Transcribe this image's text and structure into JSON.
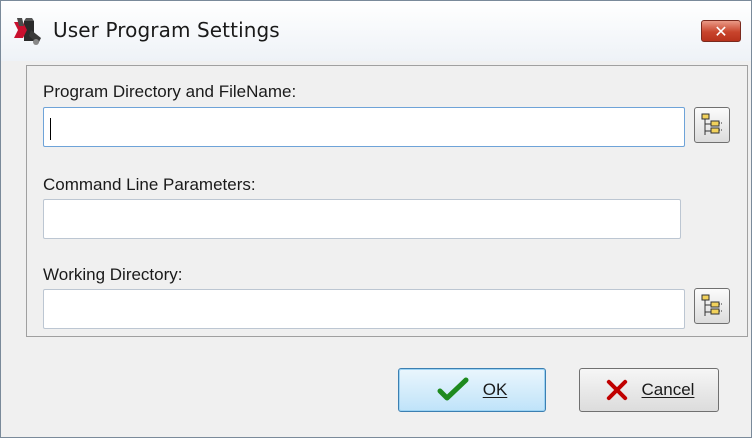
{
  "window": {
    "title": "User Program Settings",
    "close_glyph": "✕",
    "icon": "user-program-icon"
  },
  "fields": {
    "program": {
      "label": "Program Directory and FileName:",
      "value": "",
      "focused": true
    },
    "params": {
      "label": "Command Line Parameters:",
      "value": ""
    },
    "workdir": {
      "label": "Working Directory:",
      "value": ""
    }
  },
  "buttons": {
    "ok": {
      "label": "OK",
      "icon": "check-icon"
    },
    "cancel": {
      "label": "Cancel",
      "icon": "x-icon"
    }
  },
  "colors": {
    "check": "#1e8a1e",
    "cancel_x": "#c00000",
    "close_button": "#c8442c"
  }
}
